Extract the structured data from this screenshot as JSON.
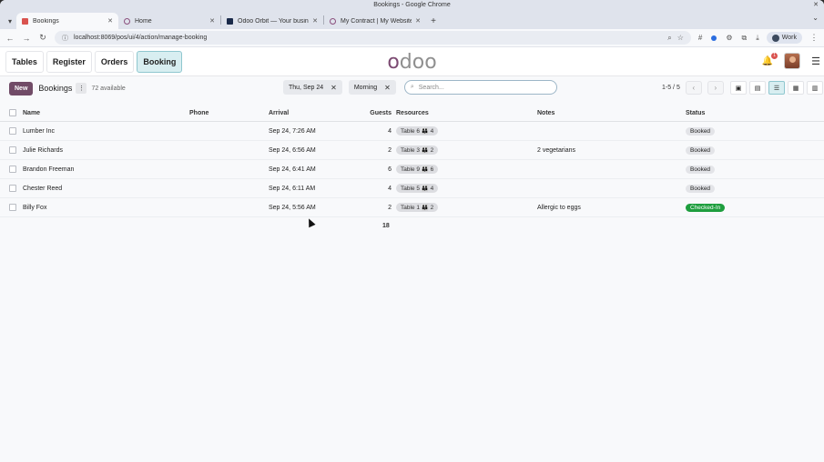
{
  "window": {
    "title": "Bookings - Google Chrome"
  },
  "tabs": [
    {
      "label": "Bookings",
      "active": true,
      "icon": "bookings"
    },
    {
      "label": "Home",
      "active": false,
      "icon": "odoo"
    },
    {
      "label": "Odoo Orbit — Your business",
      "active": false,
      "icon": "orbit"
    },
    {
      "label": "My Contract | My Website",
      "active": false,
      "icon": "odoo"
    }
  ],
  "address_bar": {
    "url": "localhost:8069/pos/ui/4/action/manage-booking"
  },
  "profile": {
    "label": "Work"
  },
  "pos": {
    "nav": [
      {
        "label": "Tables",
        "active": false
      },
      {
        "label": "Register",
        "active": false
      },
      {
        "label": "Orders",
        "active": false
      },
      {
        "label": "Booking",
        "active": true
      }
    ],
    "logo": "odoo",
    "notification_count": "1"
  },
  "control": {
    "new_label": "New",
    "breadcrumb": "Bookings",
    "available": "72 available",
    "filters": [
      {
        "label": "Thu, Sep 24"
      },
      {
        "label": "Morning"
      }
    ],
    "search_placeholder": "Search...",
    "pager": "1-5 / 5"
  },
  "table": {
    "columns": [
      "Name",
      "Phone",
      "Arrival",
      "Guests",
      "Resources",
      "Notes",
      "Status"
    ],
    "rows": [
      {
        "name": "Lumber Inc",
        "phone": "",
        "arrival": "Sep 24, 7:26 AM",
        "guests": "4",
        "resource": "Table 6 👪 4",
        "notes": "",
        "status": "Booked"
      },
      {
        "name": "Julie Richards",
        "phone": "",
        "arrival": "Sep 24, 6:56 AM",
        "guests": "2",
        "resource": "Table 3 👪 2",
        "notes": "2 vegetarians",
        "status": "Booked"
      },
      {
        "name": "Brandon Freeman",
        "phone": "",
        "arrival": "Sep 24, 6:41 AM",
        "guests": "6",
        "resource": "Table 9 👪 6",
        "notes": "",
        "status": "Booked"
      },
      {
        "name": "Chester Reed",
        "phone": "",
        "arrival": "Sep 24, 6:11 AM",
        "guests": "4",
        "resource": "Table 5 👪 4",
        "notes": "",
        "status": "Booked"
      },
      {
        "name": "Billy Fox",
        "phone": "",
        "arrival": "Sep 24, 5:56 AM",
        "guests": "2",
        "resource": "Table 1 👪 2",
        "notes": "Allergic to eggs",
        "status": "Checked-In"
      }
    ],
    "total_guests": "18"
  },
  "colors": {
    "brand": "#714b67",
    "checked_in": "#1e9e3e",
    "active_nav": "#d8eef1"
  }
}
